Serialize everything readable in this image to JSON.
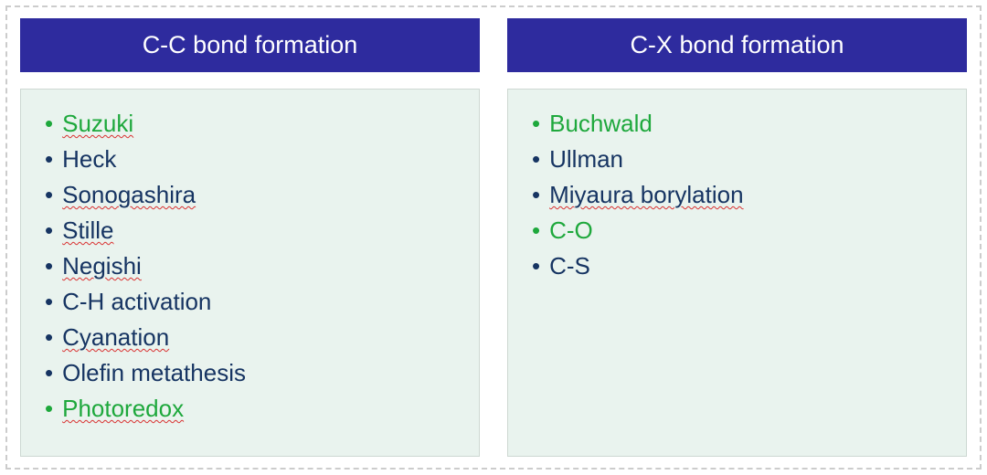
{
  "colors": {
    "header_bg": "#2e2b9e",
    "header_text": "#ffffff",
    "box_bg": "#e9f3ee",
    "box_border": "#cdd8d2",
    "green": "#1ea83c",
    "navy": "#163462",
    "spell_underline": "#d93030"
  },
  "columns": [
    {
      "header": "C-C bond formation",
      "items": [
        {
          "label": "Suzuki",
          "color": "green",
          "spell": true
        },
        {
          "label": "Heck",
          "color": "navy",
          "spell": false
        },
        {
          "label": "Sonogashira",
          "color": "navy",
          "spell": true
        },
        {
          "label": "Stille",
          "color": "navy",
          "spell": true
        },
        {
          "label": "Negishi",
          "color": "navy",
          "spell": true
        },
        {
          "label": "C-H activation",
          "color": "navy",
          "spell": false
        },
        {
          "label": "Cyanation",
          "color": "navy",
          "spell": true
        },
        {
          "label": "Olefin metathesis",
          "color": "navy",
          "spell": false
        },
        {
          "label": "Photoredox",
          "color": "green",
          "spell": true
        }
      ]
    },
    {
      "header": "C-X bond formation",
      "items": [
        {
          "label": "Buchwald",
          "color": "green",
          "spell": false
        },
        {
          "label": "Ullman",
          "color": "navy",
          "spell": false
        },
        {
          "label": "Miyaura borylation",
          "color": "navy",
          "spell": true
        },
        {
          "label": "C-O",
          "color": "green",
          "spell": false
        },
        {
          "label": "C-S",
          "color": "navy",
          "spell": false
        }
      ]
    }
  ]
}
